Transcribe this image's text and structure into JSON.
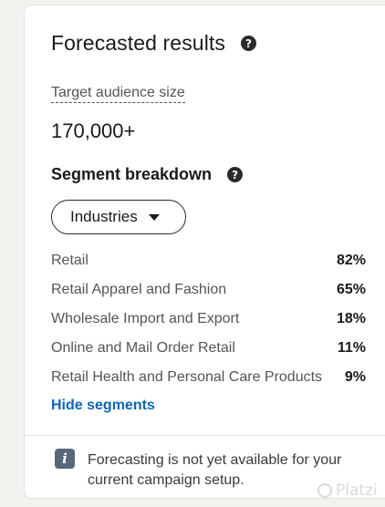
{
  "forecast": {
    "title": "Forecasted results",
    "help_icon": "question-circle-icon"
  },
  "audience": {
    "label": "Target audience size",
    "value": "170,000+"
  },
  "segments": {
    "title": "Segment breakdown",
    "help_icon": "question-circle-icon",
    "dropdown": {
      "selected": "Industries",
      "icon": "caret-down-icon"
    },
    "items": [
      {
        "name": "Retail",
        "percent": "82%"
      },
      {
        "name": "Retail Apparel and Fashion",
        "percent": "65%"
      },
      {
        "name": "Wholesale Import and Export",
        "percent": "18%"
      },
      {
        "name": "Online and Mail Order Retail",
        "percent": "11%"
      },
      {
        "name": "Retail Health and Personal Care Products",
        "percent": "9%"
      }
    ],
    "hide_link": "Hide segments"
  },
  "notice": {
    "icon": "info-icon",
    "text": "Forecasting is not yet available for your current campaign setup."
  },
  "watermark": {
    "text": "Platzi"
  },
  "colors": {
    "link": "#0a66c2",
    "background": "#f3f2ef",
    "card": "#ffffff"
  }
}
